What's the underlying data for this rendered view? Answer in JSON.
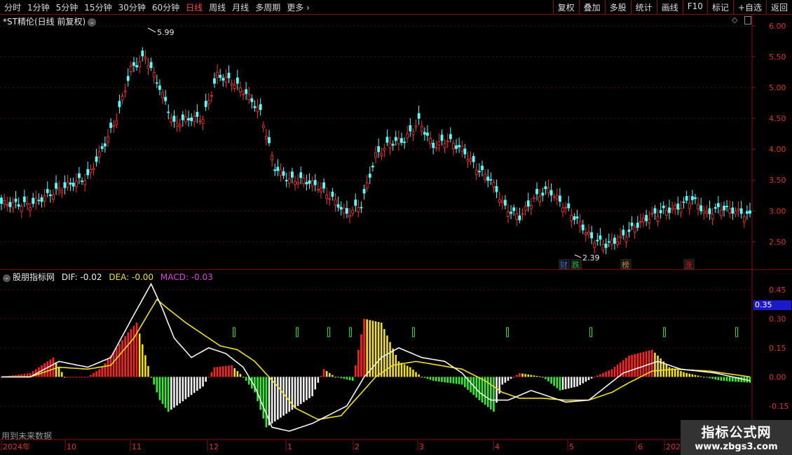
{
  "toolbar": {
    "periods": [
      "分时",
      "1分钟",
      "5分钟",
      "15分钟",
      "30分钟",
      "60分钟",
      "日线",
      "周线",
      "月线",
      "多周期",
      "更多 ›"
    ],
    "active_index": 6,
    "right_buttons": [
      "复权",
      "叠加",
      "多股",
      "统计",
      "画线",
      "F10",
      "标记",
      "+自选",
      "返回"
    ]
  },
  "main_chart": {
    "title": "*ST精伦(日线 前复权)",
    "high_label": "5.99",
    "low_label": "2.39",
    "price_ticks": [
      "6.00",
      "5.50",
      "5.00",
      "4.50",
      "4.00",
      "3.50",
      "3.00",
      "2.50"
    ],
    "markers": [
      {
        "text": "财",
        "color": "#3a6fd8"
      },
      {
        "text": "跌",
        "color": "#22bb22"
      },
      {
        "text": "榜",
        "color": "#d09020"
      },
      {
        "text": "涨",
        "color": "#dd2222"
      }
    ]
  },
  "indicator": {
    "name": "股朋指标网",
    "dif_label": "DIF: -0.02",
    "dea_label": "DEA: -0.00",
    "macd_label": "MACD: -0.03",
    "ticks": [
      "0.45",
      "0.30",
      "0.15",
      "0.00",
      "-0.15"
    ],
    "current_value": "0.35",
    "future_note": "用到未来数据"
  },
  "date_axis": [
    "2024年",
    "10",
    "11",
    "12",
    "1",
    "2",
    "3",
    "4",
    "5",
    "6",
    "202"
  ],
  "watermark": {
    "line1": "指标公式网",
    "line2": "www.zbgs3.com"
  },
  "chart_data": {
    "type": "candlestick",
    "price_axis": {
      "ylim": [
        2.3,
        6.1
      ]
    },
    "indicator_axis": {
      "ylim": [
        -0.32,
        0.5
      ]
    },
    "close_anchors": [
      [
        0,
        3.12
      ],
      [
        10,
        3.1
      ],
      [
        20,
        3.35
      ],
      [
        30,
        3.55
      ],
      [
        35,
        4.0
      ],
      [
        40,
        4.5
      ],
      [
        45,
        5.3
      ],
      [
        50,
        5.5
      ],
      [
        55,
        5.0
      ],
      [
        60,
        4.4
      ],
      [
        65,
        4.5
      ],
      [
        70,
        4.5
      ],
      [
        75,
        5.2
      ],
      [
        80,
        5.1
      ],
      [
        85,
        4.9
      ],
      [
        90,
        4.6
      ],
      [
        95,
        3.7
      ],
      [
        100,
        3.5
      ],
      [
        105,
        3.5
      ],
      [
        110,
        3.4
      ],
      [
        115,
        3.2
      ],
      [
        120,
        2.95
      ],
      [
        125,
        3.1
      ],
      [
        130,
        3.9
      ],
      [
        135,
        4.1
      ],
      [
        140,
        4.15
      ],
      [
        145,
        4.45
      ],
      [
        150,
        4.05
      ],
      [
        155,
        4.15
      ],
      [
        160,
        4.0
      ],
      [
        165,
        3.7
      ],
      [
        170,
        3.5
      ],
      [
        175,
        3.05
      ],
      [
        180,
        2.9
      ],
      [
        185,
        3.2
      ],
      [
        190,
        3.35
      ],
      [
        195,
        3.1
      ],
      [
        200,
        2.85
      ],
      [
        205,
        2.55
      ],
      [
        210,
        2.45
      ],
      [
        215,
        2.55
      ],
      [
        220,
        2.75
      ],
      [
        225,
        2.9
      ],
      [
        230,
        3.0
      ],
      [
        235,
        3.05
      ],
      [
        240,
        3.2
      ],
      [
        245,
        2.95
      ],
      [
        250,
        3.05
      ],
      [
        255,
        3.0
      ],
      [
        260,
        2.92
      ]
    ],
    "macd_hist": [
      [
        0,
        0.0
      ],
      [
        10,
        0.02
      ],
      [
        18,
        0.1
      ],
      [
        22,
        0.0
      ],
      [
        30,
        0.0
      ],
      [
        35,
        0.05
      ],
      [
        44,
        0.23
      ],
      [
        47,
        0.28
      ],
      [
        52,
        0.0
      ],
      [
        55,
        -0.12
      ],
      [
        58,
        -0.18
      ],
      [
        70,
        -0.05
      ],
      [
        74,
        0.05
      ],
      [
        80,
        0.06
      ],
      [
        84,
        0.0
      ],
      [
        88,
        -0.08
      ],
      [
        92,
        -0.26
      ],
      [
        98,
        -0.2
      ],
      [
        108,
        -0.1
      ],
      [
        112,
        0.04
      ],
      [
        116,
        0.0
      ],
      [
        122,
        -0.02
      ],
      [
        126,
        0.3
      ],
      [
        132,
        0.28
      ],
      [
        138,
        0.08
      ],
      [
        142,
        0.05
      ],
      [
        146,
        0.0
      ],
      [
        150,
        -0.02
      ],
      [
        160,
        -0.04
      ],
      [
        166,
        -0.12
      ],
      [
        171,
        -0.18
      ],
      [
        174,
        -0.04
      ],
      [
        180,
        0.02
      ],
      [
        188,
        0.0
      ],
      [
        194,
        -0.07
      ],
      [
        200,
        -0.05
      ],
      [
        206,
        0.0
      ],
      [
        212,
        0.04
      ],
      [
        218,
        0.11
      ],
      [
        226,
        0.14
      ],
      [
        232,
        0.05
      ],
      [
        238,
        0.02
      ],
      [
        250,
        -0.02
      ],
      [
        260,
        -0.03
      ]
    ],
    "dif": [
      [
        0,
        0.0
      ],
      [
        10,
        0.0
      ],
      [
        20,
        0.08
      ],
      [
        30,
        0.05
      ],
      [
        38,
        0.1
      ],
      [
        46,
        0.32
      ],
      [
        52,
        0.48
      ],
      [
        56,
        0.35
      ],
      [
        60,
        0.2
      ],
      [
        66,
        0.1
      ],
      [
        72,
        0.15
      ],
      [
        78,
        0.12
      ],
      [
        84,
        0.05
      ],
      [
        88,
        -0.05
      ],
      [
        94,
        -0.26
      ],
      [
        100,
        -0.28
      ],
      [
        108,
        -0.24
      ],
      [
        116,
        -0.18
      ],
      [
        120,
        -0.15
      ],
      [
        126,
        0.0
      ],
      [
        132,
        0.1
      ],
      [
        138,
        0.15
      ],
      [
        146,
        0.1
      ],
      [
        154,
        0.08
      ],
      [
        160,
        0.02
      ],
      [
        166,
        -0.08
      ],
      [
        170,
        -0.12
      ],
      [
        176,
        -0.12
      ],
      [
        184,
        -0.07
      ],
      [
        190,
        -0.1
      ],
      [
        196,
        -0.13
      ],
      [
        204,
        -0.12
      ],
      [
        210,
        -0.05
      ],
      [
        216,
        0.02
      ],
      [
        222,
        0.05
      ],
      [
        228,
        0.08
      ],
      [
        236,
        0.04
      ],
      [
        248,
        0.02
      ],
      [
        260,
        -0.02
      ]
    ],
    "dea": [
      [
        0,
        0.0
      ],
      [
        10,
        0.0
      ],
      [
        20,
        0.05
      ],
      [
        30,
        0.04
      ],
      [
        38,
        0.06
      ],
      [
        46,
        0.2
      ],
      [
        54,
        0.4
      ],
      [
        58,
        0.35
      ],
      [
        64,
        0.28
      ],
      [
        70,
        0.22
      ],
      [
        76,
        0.16
      ],
      [
        82,
        0.14
      ],
      [
        88,
        0.08
      ],
      [
        96,
        -0.05
      ],
      [
        102,
        -0.16
      ],
      [
        110,
        -0.22
      ],
      [
        118,
        -0.2
      ],
      [
        124,
        -0.1
      ],
      [
        130,
        0.0
      ],
      [
        136,
        0.06
      ],
      [
        144,
        0.08
      ],
      [
        152,
        0.06
      ],
      [
        160,
        0.04
      ],
      [
        168,
        -0.02
      ],
      [
        174,
        -0.08
      ],
      [
        180,
        -0.11
      ],
      [
        188,
        -0.11
      ],
      [
        196,
        -0.12
      ],
      [
        204,
        -0.12
      ],
      [
        212,
        -0.08
      ],
      [
        218,
        -0.03
      ],
      [
        226,
        0.03
      ],
      [
        234,
        0.04
      ],
      [
        246,
        0.03
      ],
      [
        260,
        0.0
      ]
    ]
  }
}
